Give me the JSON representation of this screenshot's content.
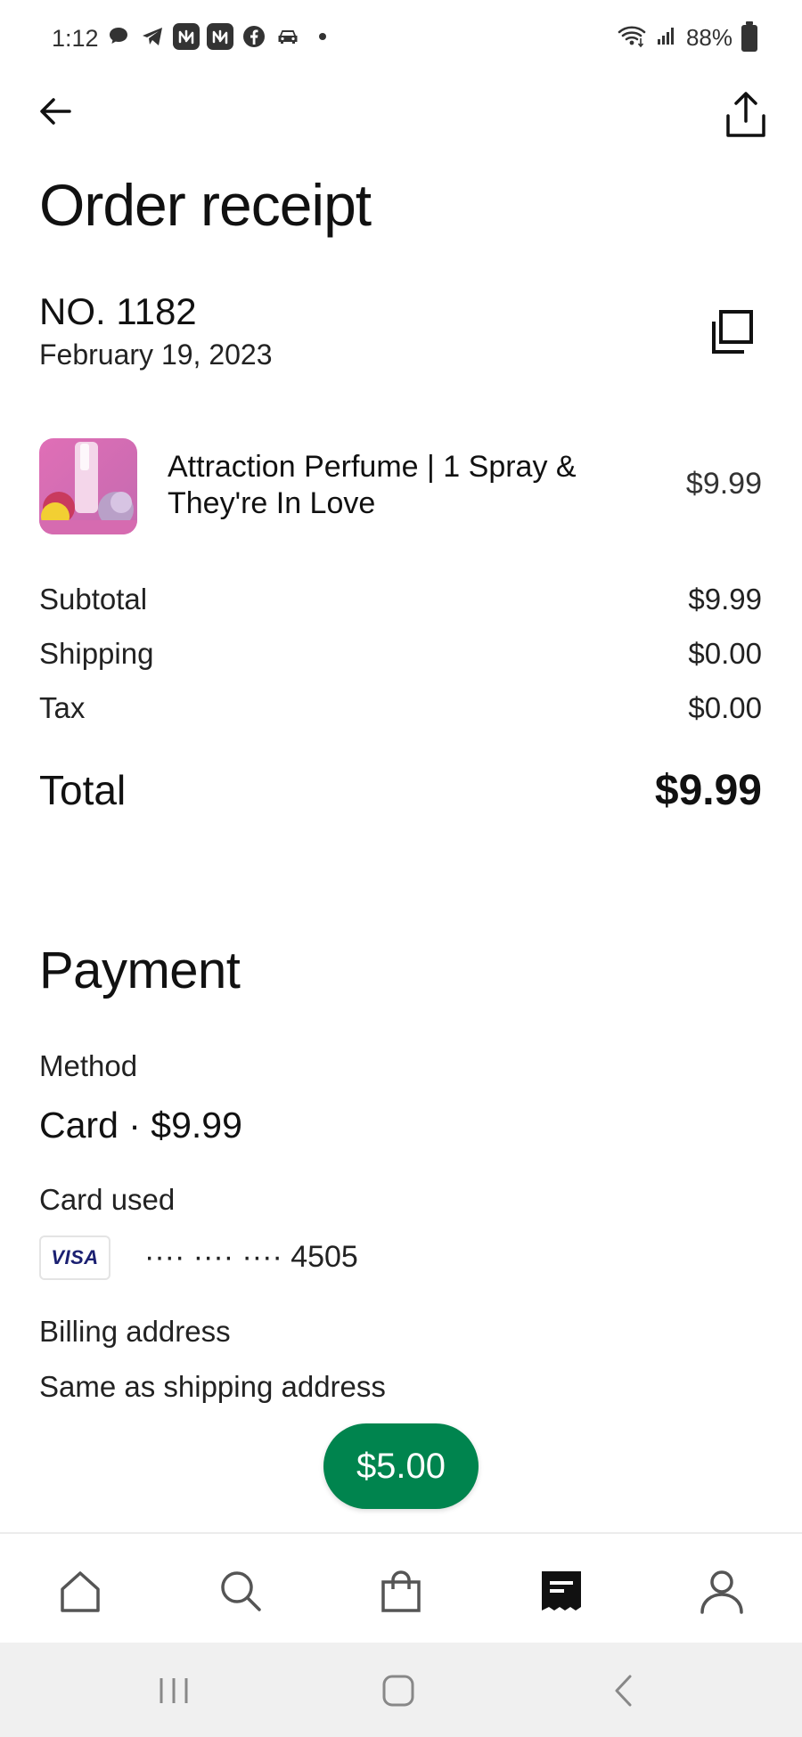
{
  "status_bar": {
    "time": "1:12",
    "battery": "88%"
  },
  "header": {
    "title": "Order receipt"
  },
  "order": {
    "number": "NO. 1182",
    "date": "February 19, 2023"
  },
  "item": {
    "title": "Attraction Perfume | 1 Spray & They're In Love",
    "price": "$9.99"
  },
  "summary": {
    "subtotal_label": "Subtotal",
    "subtotal_value": "$9.99",
    "shipping_label": "Shipping",
    "shipping_value": "$0.00",
    "tax_label": "Tax",
    "tax_value": "$0.00",
    "total_label": "Total",
    "total_value": "$9.99"
  },
  "payment": {
    "section_title": "Payment",
    "method_label": "Method",
    "method_value": "Card · $9.99",
    "card_used_label": "Card used",
    "card_brand": "VISA",
    "card_number": "···· ···· ···· 4505",
    "billing_label": "Billing address",
    "billing_value": "Same as shipping address"
  },
  "floating_pill": {
    "label": "$5.00"
  },
  "bottom_nav": {
    "items": [
      "home-icon",
      "search-icon",
      "shopping-bag-icon",
      "receipt-icon",
      "profile-icon"
    ],
    "active": "receipt-icon"
  },
  "colors": {
    "accent_green": "#00844e",
    "text_primary": "#111111",
    "visa_blue": "#1a1f71"
  }
}
